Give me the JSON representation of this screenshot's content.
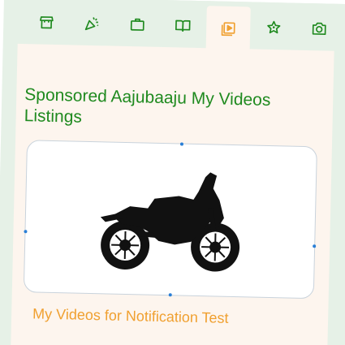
{
  "tabs": [
    {
      "name": "store",
      "icon": "store-icon",
      "active": false
    },
    {
      "name": "celebrate",
      "icon": "party-popper-icon",
      "active": false
    },
    {
      "name": "business",
      "icon": "briefcase-icon",
      "active": false
    },
    {
      "name": "reading",
      "icon": "open-book-icon",
      "active": false
    },
    {
      "name": "videos",
      "icon": "video-library-icon",
      "active": true
    },
    {
      "name": "favorites",
      "icon": "star-sparkle-icon",
      "active": false
    },
    {
      "name": "photos",
      "icon": "camera-icon",
      "active": false
    }
  ],
  "colors": {
    "tab_bar_bg": "#e6f1e7",
    "panel_bg": "#fdf5ee",
    "green": "#1f8a1f",
    "orange": "#f0a030",
    "handle_blue": "#2a7fd6"
  },
  "main": {
    "section_title": "Sponsored Aajubaaju My Videos Listings",
    "card": {
      "image": "motorcycle-silhouette",
      "title": "My Videos for Notification Test"
    }
  }
}
